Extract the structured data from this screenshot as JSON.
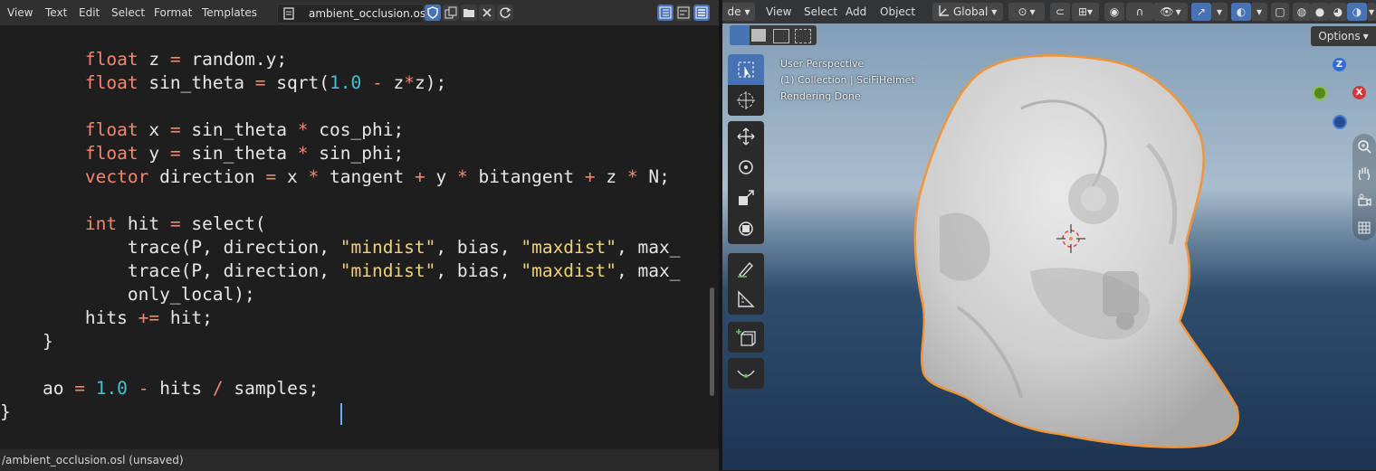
{
  "editor": {
    "menu": [
      "View",
      "Text",
      "Edit",
      "Select",
      "Format",
      "Templates"
    ],
    "file_name": "ambient_occlusion.osl",
    "status": "/ambient_occlusion.osl (unsaved)",
    "code": [
      {
        "text": "        float z = random.y;"
      },
      {
        "text": "        float sin_theta = sqrt(1.0 - z*z);"
      },
      {
        "text": ""
      },
      {
        "text": "        float x = sin_theta * cos_phi;"
      },
      {
        "text": "        float y = sin_theta * sin_phi;"
      },
      {
        "text": "        vector direction = x * tangent + y * bitangent + z * N;"
      },
      {
        "text": ""
      },
      {
        "text": "        int hit = select("
      },
      {
        "text": "            trace(P, direction, \"mindist\", bias, \"maxdist\", max_"
      },
      {
        "text": "            trace(P, direction, \"mindist\", bias, \"maxdist\", max_"
      },
      {
        "text": "            only_local);"
      },
      {
        "text": "        hits += hit;"
      },
      {
        "text": "    }"
      },
      {
        "text": ""
      },
      {
        "text": "    ao = 1.0 - hits / samples;"
      },
      {
        "text": "}"
      }
    ]
  },
  "viewport": {
    "mode_partial": "de",
    "menu": [
      "View",
      "Select",
      "Add",
      "Object"
    ],
    "transform_orientation": "Global",
    "options_label": "Options",
    "overlay": {
      "line1": "User Perspective",
      "line2": "(1) Collection | SciFiHelmet",
      "line3": "Rendering Done"
    },
    "gizmo": {
      "z": "Z",
      "x": "X"
    },
    "colors": {
      "selection_outline": "#f0953a",
      "active_tool": "#4772b3"
    }
  }
}
